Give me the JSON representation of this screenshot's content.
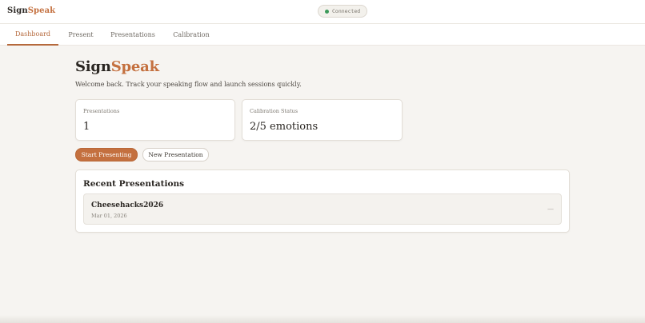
{
  "brand": {
    "part1": "Sign",
    "part2": "Speak"
  },
  "status": {
    "label": "Connected",
    "color": "#3c9a5a"
  },
  "tabs": [
    {
      "label": "Dashboard",
      "active": true
    },
    {
      "label": "Present",
      "active": false
    },
    {
      "label": "Presentations",
      "active": false
    },
    {
      "label": "Calibration",
      "active": false
    }
  ],
  "hero": {
    "title_part1": "Sign",
    "title_part2": "Speak",
    "subtitle": "Welcome back. Track your speaking flow and launch sessions quickly."
  },
  "stats": [
    {
      "label": "Presentations",
      "value": "1"
    },
    {
      "label": "Calibration Status",
      "value": "2/5 emotions"
    }
  ],
  "actions": {
    "start_label": "Start Presenting",
    "new_label": "New Presentation"
  },
  "recent": {
    "title": "Recent Presentations",
    "items": [
      {
        "name": "Cheesehacks2026",
        "date": "Mar 01, 2026",
        "menu": "—"
      }
    ]
  },
  "colors": {
    "accent": "#c4703f",
    "background": "#f6f4f1",
    "card": "#ffffff"
  }
}
